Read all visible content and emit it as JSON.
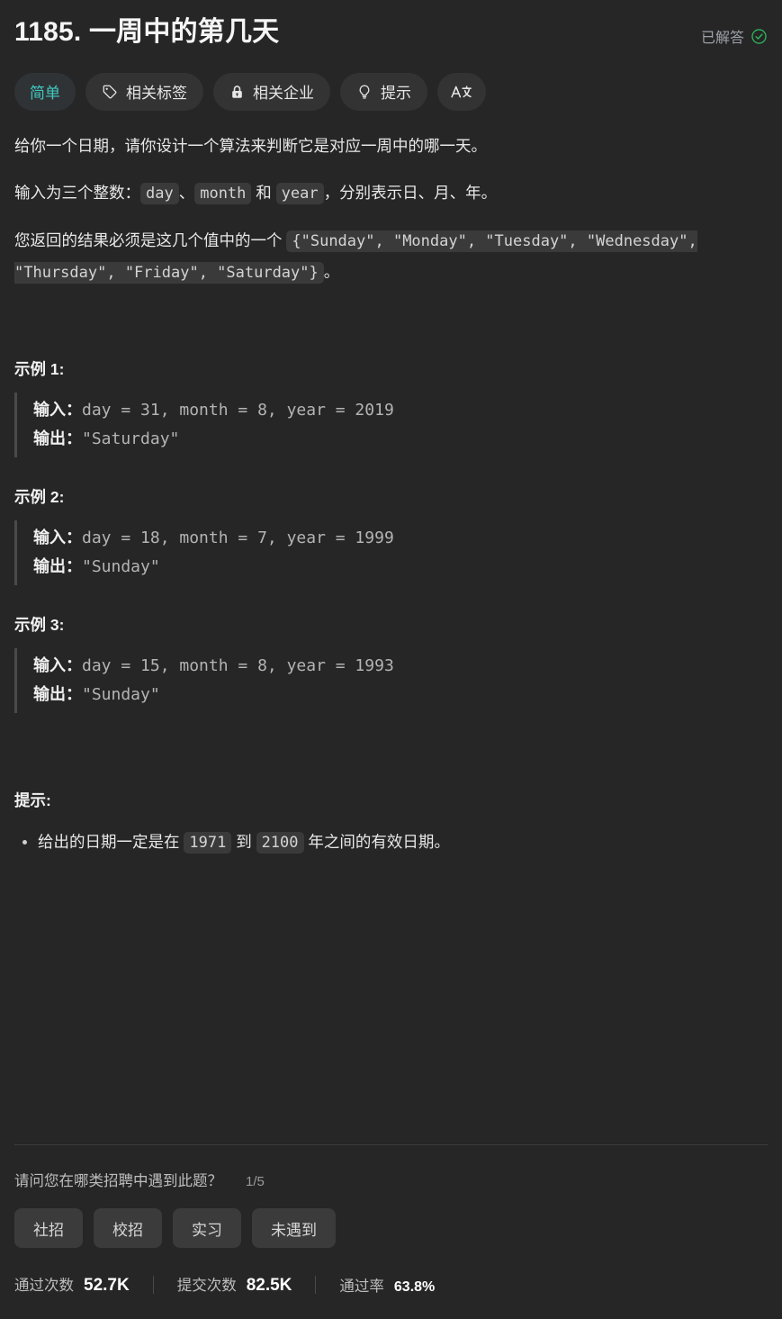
{
  "header": {
    "title": "1185. 一周中的第几天",
    "solved_label": "已解答",
    "solved_icon": "check-circle-icon",
    "solved_color": "#2db55d"
  },
  "tags": {
    "difficulty": {
      "label": "简单",
      "color": "#41c8c0"
    },
    "items": [
      {
        "label": "相关标签",
        "icon": "tag-icon"
      },
      {
        "label": "相关企业",
        "icon": "lock-icon"
      },
      {
        "label": "提示",
        "icon": "lightbulb-icon"
      },
      {
        "label": "",
        "icon": "translate-icon"
      }
    ]
  },
  "description": {
    "p1": "给你一个日期，请你设计一个算法来判断它是对应一周中的哪一天。",
    "p2_prefix": "输入为三个整数：",
    "p2_code1": "day",
    "p2_sep1": "、",
    "p2_code2": "month",
    "p2_sep2": " 和 ",
    "p2_code3": "year",
    "p2_suffix": "，分别表示日、月、年。",
    "p3_prefix": "您返回的结果必须是这几个值中的一个 ",
    "p3_code": "{\"Sunday\", \"Monday\", \"Tuesday\", \"Wednesday\", \"Thursday\", \"Friday\", \"Saturday\"}",
    "p3_suffix": "。"
  },
  "examples": [
    {
      "heading": "示例 1:",
      "input_label": "输入：",
      "input_value": "day = 31, month = 8, year = 2019",
      "output_label": "输出：",
      "output_value": "\"Saturday\""
    },
    {
      "heading": "示例 2:",
      "input_label": "输入：",
      "input_value": "day = 18, month = 7, year = 1999",
      "output_label": "输出：",
      "output_value": "\"Sunday\""
    },
    {
      "heading": "示例 3:",
      "input_label": "输入：",
      "input_value": "day = 15, month = 8, year = 1993",
      "output_label": "输出：",
      "output_value": "\"Sunday\""
    }
  ],
  "hints": {
    "heading": "提示:",
    "item_prefix": "给出的日期一定是在 ",
    "item_code1": "1971",
    "item_mid": " 到 ",
    "item_code2": "2100",
    "item_suffix": " 年之间的有效日期。"
  },
  "survey": {
    "question": "请问您在哪类招聘中遇到此题？",
    "counter": "1/5",
    "options": [
      "社招",
      "校招",
      "实习",
      "未遇到"
    ]
  },
  "stats": [
    {
      "label": "通过次数",
      "value": "52.7K"
    },
    {
      "label": "提交次数",
      "value": "82.5K"
    },
    {
      "label": "通过率",
      "value": "63.8%"
    }
  ]
}
